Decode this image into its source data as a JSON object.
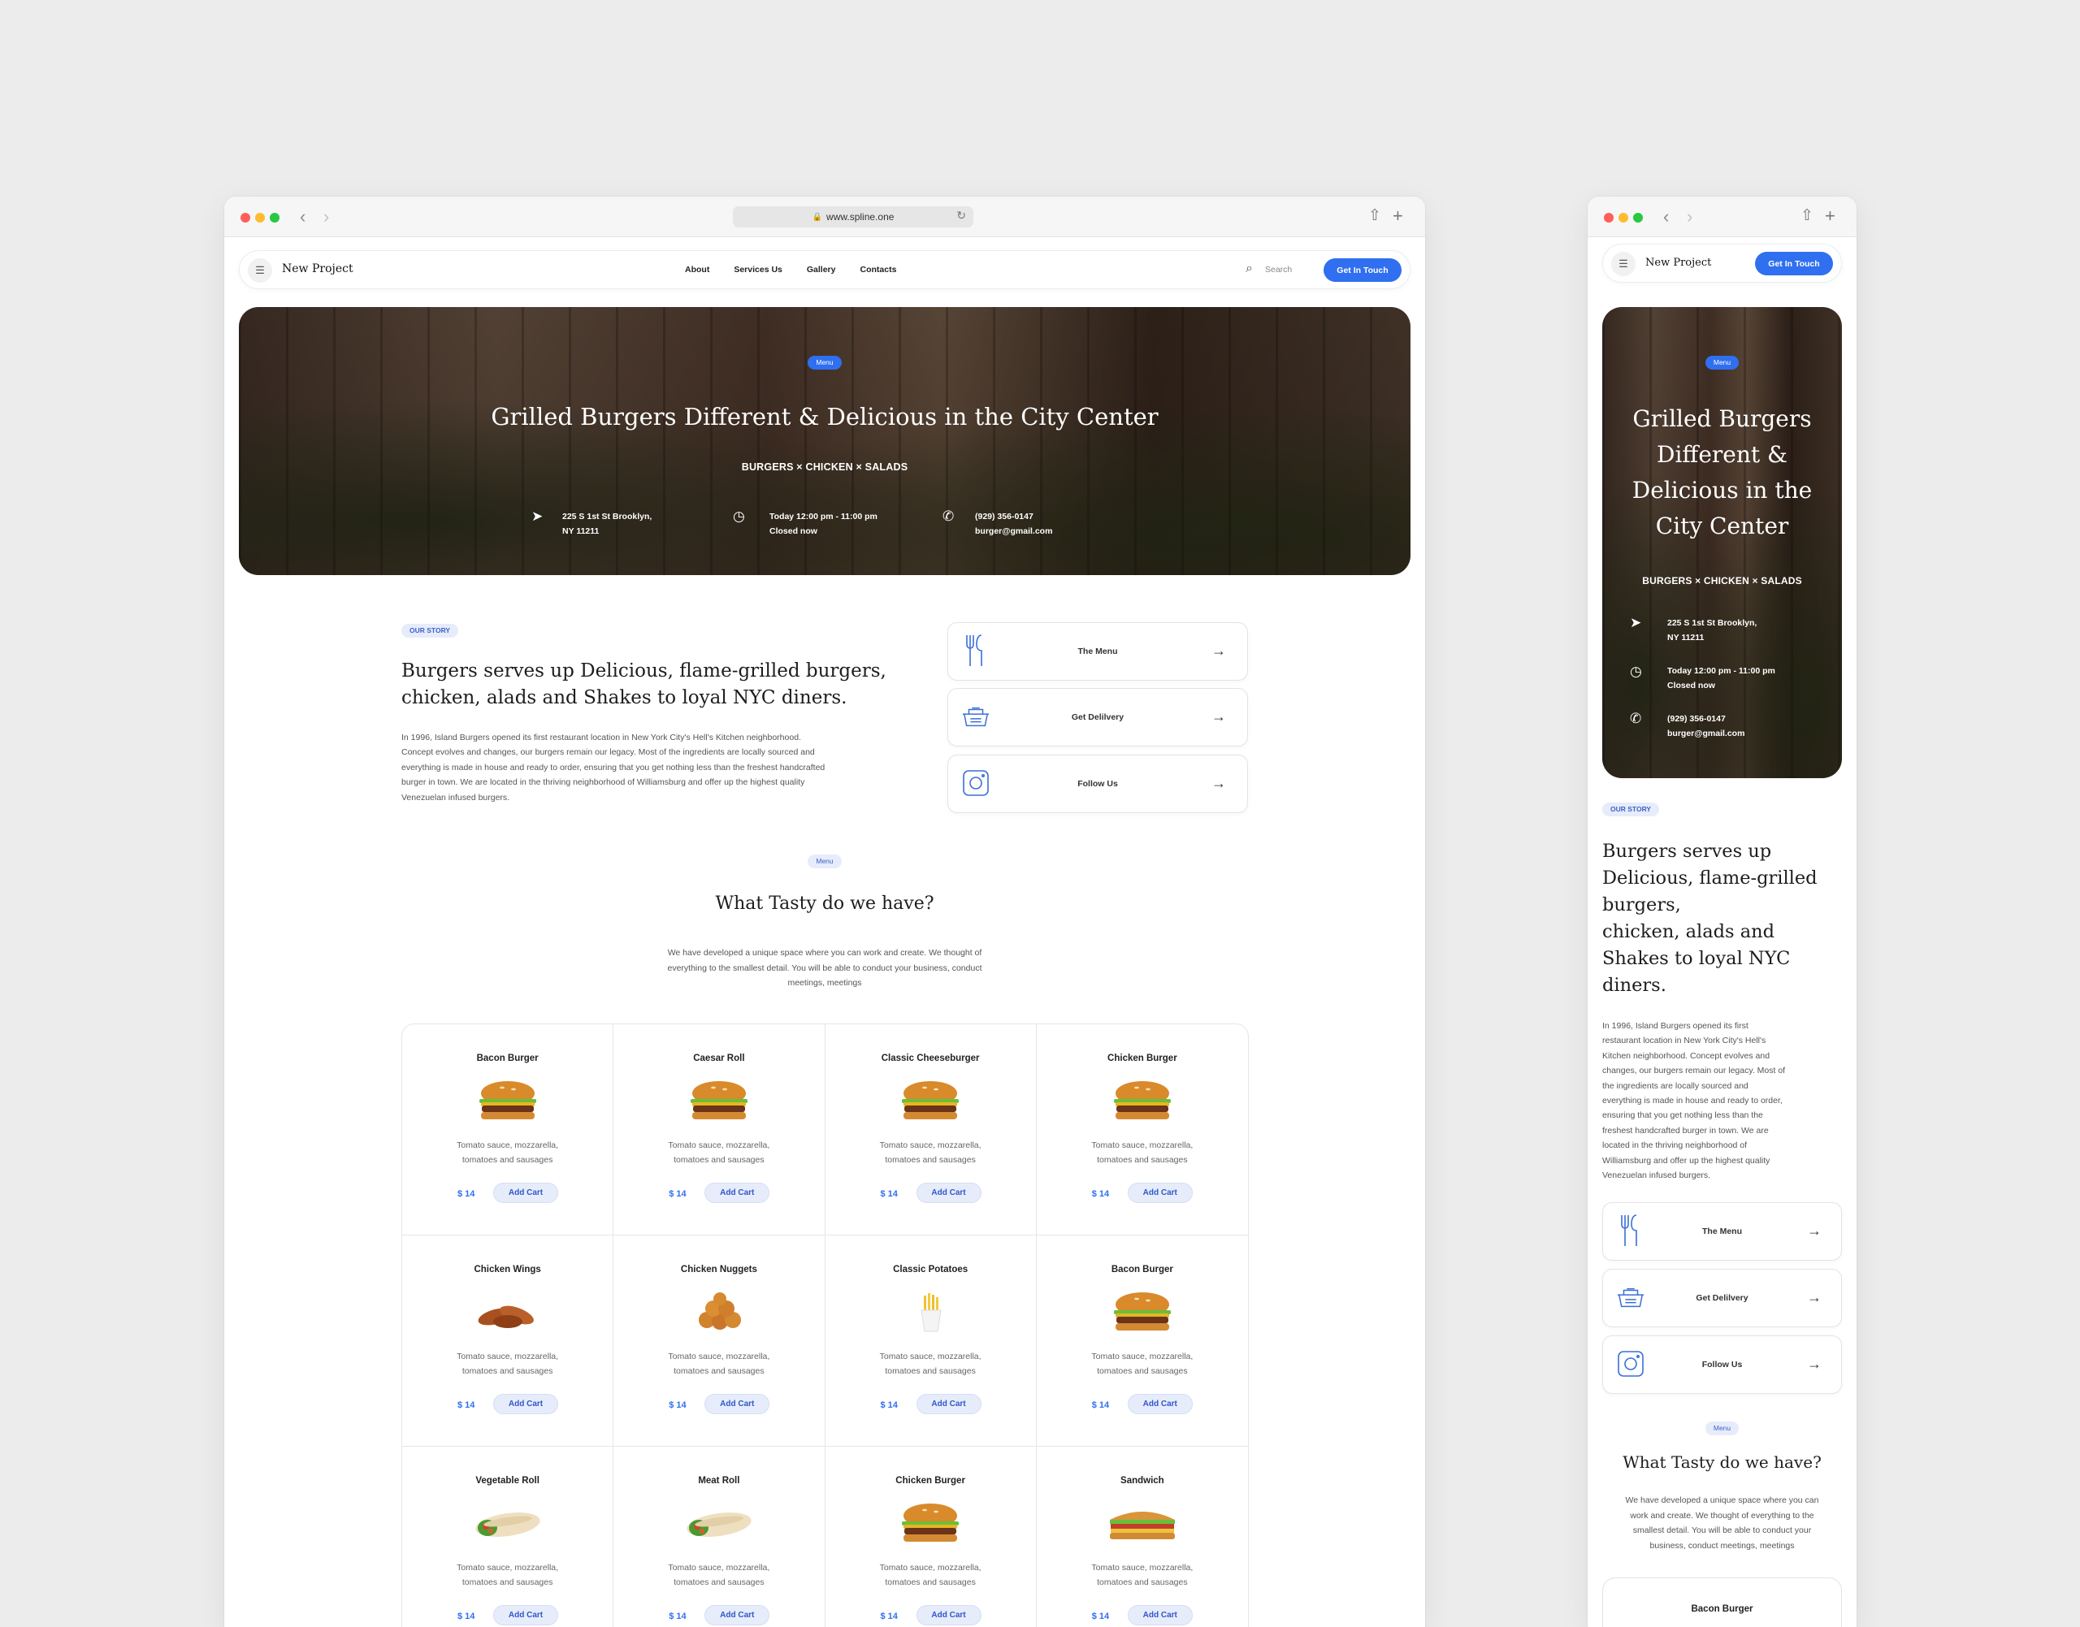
{
  "browser": {
    "url": "www.spline.one"
  },
  "nav": {
    "brand": "New Project",
    "links": [
      "About",
      "Services Us",
      "Gallery",
      "Contacts"
    ],
    "search_label": "Search",
    "cta": "Get In Touch"
  },
  "hero": {
    "pill": "Menu",
    "title": "Grilled Burgers Different & Delicious in the City Center",
    "subtitle": "BURGERS × CHICKEN  × SALADS",
    "address_line1": "225 S 1st St Brooklyn,",
    "address_line2": "NY 11211",
    "hours_line1": "Today 12:00 pm - 11:00 pm",
    "hours_line2": "Closed now",
    "phone": "(929) 356-0147",
    "email": "burger@gmail.com"
  },
  "story": {
    "pill": "OUR STORY",
    "title": "Burgers serves up Delicious, flame-grilled burgers, chicken, alads and Shakes to loyal NYC diners.",
    "title_line1": "Burgers serves up Delicious, flame-grilled burgers,",
    "title_line2": "chicken, alads and Shakes to loyal NYC diners.",
    "mobile_title_lines": [
      "Burgers serves up",
      "Delicious, flame-grilled",
      "burgers,",
      "chicken, alads and",
      "Shakes to loyal NYC",
      "diners."
    ],
    "body_lines": [
      "In 1996, Island Burgers opened its first restaurant location in New York City's Hell's Kitchen neighborhood.",
      "Concept evolves and changes, our burgers remain our legacy. Most of the ingredients are locally sourced and",
      "everything is made in house and ready to order, ensuring that you get nothing less than the freshest handcrafted",
      "burger in town.  We are located in the thriving neighborhood of Williamsburg and offer up the highest quality",
      "Venezuelan infused burgers."
    ],
    "mobile_body_lines": [
      "In 1996, Island Burgers opened its first",
      "restaurant location in New York City's Hell's",
      "Kitchen neighborhood.  Concept evolves and",
      "changes, our burgers remain our legacy. Most of",
      "the ingredients are locally sourced and",
      "everything is made in house and ready to order,",
      "ensuring that you get nothing less than the",
      "freshest handcrafted burger in town.  We are",
      "located in the thriving neighborhood of",
      "Williamsburg and offer up the highest quality",
      "Venezuelan infused burgers."
    ]
  },
  "actions": [
    {
      "label": "The Menu",
      "icon": "fork-knife-icon"
    },
    {
      "label": "Get Delilvery",
      "icon": "delivery-box-icon"
    },
    {
      "label": "Follow Us",
      "icon": "instagram-icon"
    }
  ],
  "menu": {
    "pill": "Menu",
    "title": "What Tasty do we have?",
    "intro_lines": [
      "We have developed a unique space where you can work and create. We thought of",
      "everything to the smallest detail. You will be able to conduct your business, conduct",
      "meetings, meetings"
    ],
    "mobile_intro_lines": [
      "We have developed a unique space where you can",
      "work and create. We thought of everything to the",
      "smallest detail. You will be able to conduct your",
      "business, conduct meetings, meetings"
    ],
    "items": [
      {
        "name": "Bacon Burger",
        "desc1": "Tomato sauce, mozzarella,",
        "desc2": "tomatoes and sausages",
        "price": "$ 14",
        "add": "Add Cart",
        "icon": "burger"
      },
      {
        "name": "Caesar Roll",
        "desc1": "Tomato sauce, mozzarella,",
        "desc2": "tomatoes and sausages",
        "price": "$ 14",
        "add": "Add Cart",
        "icon": "burger"
      },
      {
        "name": "Classic Cheeseburger",
        "desc1": "Tomato sauce, mozzarella,",
        "desc2": "tomatoes and sausages",
        "price": "$ 14",
        "add": "Add Cart",
        "icon": "burger"
      },
      {
        "name": "Chicken Burger",
        "desc1": "Tomato sauce, mozzarella,",
        "desc2": "tomatoes and sausages",
        "price": "$ 14",
        "add": "Add Cart",
        "icon": "burger"
      },
      {
        "name": "Chicken Wings",
        "desc1": "Tomato sauce, mozzarella,",
        "desc2": "tomatoes and sausages",
        "price": "$ 14",
        "add": "Add Cart",
        "icon": "wings"
      },
      {
        "name": "Chicken Nuggets",
        "desc1": "Tomato sauce, mozzarella,",
        "desc2": "tomatoes and sausages",
        "price": "$ 14",
        "add": "Add Cart",
        "icon": "nuggets"
      },
      {
        "name": "Classic Potatoes",
        "desc1": "Tomato sauce, mozzarella,",
        "desc2": "tomatoes and sausages",
        "price": "$ 14",
        "add": "Add Cart",
        "icon": "fries"
      },
      {
        "name": "Bacon Burger",
        "desc1": "Tomato sauce, mozzarella,",
        "desc2": "tomatoes and sausages",
        "price": "$ 14",
        "add": "Add Cart",
        "icon": "burger"
      },
      {
        "name": "Vegetable Roll",
        "desc1": "Tomato sauce, mozzarella,",
        "desc2": "tomatoes and sausages",
        "price": "$ 14",
        "add": "Add Cart",
        "icon": "wrap"
      },
      {
        "name": "Meat Roll",
        "desc1": "Tomato sauce, mozzarella,",
        "desc2": "tomatoes and sausages",
        "price": "$ 14",
        "add": "Add Cart",
        "icon": "wrap"
      },
      {
        "name": "Chicken Burger",
        "desc1": "Tomato sauce, mozzarella,",
        "desc2": "tomatoes and sausages",
        "price": "$ 14",
        "add": "Add Cart",
        "icon": "burger"
      },
      {
        "name": "Sandwich",
        "desc1": "Tomato sauce, mozzarella,",
        "desc2": "tomatoes and sausages",
        "price": "$ 14",
        "add": "Add Cart",
        "icon": "sandwich"
      }
    ],
    "mobile_first_item": "Bacon Burger"
  },
  "colors": {
    "accent": "#2f6ff0",
    "pill_light_bg": "#e7ecfb",
    "page_bg": "#ececec"
  }
}
